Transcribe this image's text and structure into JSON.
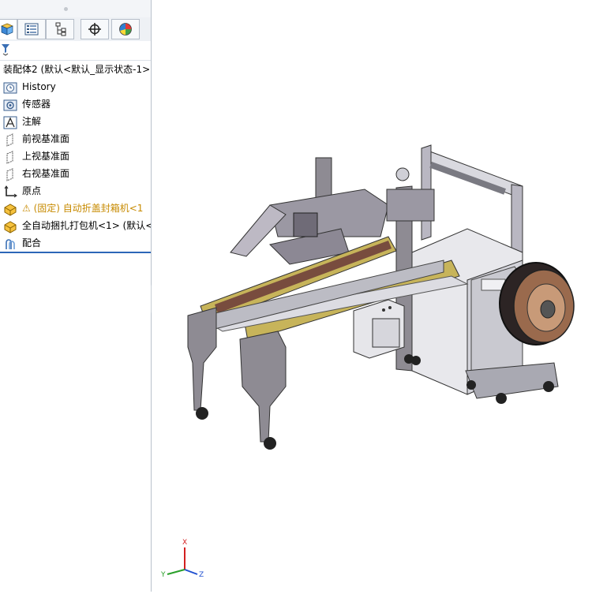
{
  "feature_tree": {
    "root_label": "装配体2  (默认<默认_显示状态-1>",
    "items": [
      {
        "label": "History",
        "icon": "history-icon"
      },
      {
        "label": "传感器",
        "icon": "sensor-icon"
      },
      {
        "label": "注解",
        "icon": "annotation-icon"
      },
      {
        "label": "前视基准面",
        "icon": "plane-icon"
      },
      {
        "label": "上视基准面",
        "icon": "plane-icon"
      },
      {
        "label": "右视基准面",
        "icon": "plane-icon"
      },
      {
        "label": "原点",
        "icon": "origin-icon"
      },
      {
        "label": "⚠ (固定) 自动折盖封箱机<1",
        "icon": "part-warning-icon",
        "color": "#c78a00"
      },
      {
        "label": "全自动捆扎打包机<1> (默认<",
        "icon": "part-icon"
      },
      {
        "label": "配合",
        "icon": "mates-icon"
      }
    ]
  },
  "tabs": [
    {
      "name": "featuremanager-tab",
      "icon": "cube-icon"
    },
    {
      "name": "propertymanager-tab",
      "icon": "property-list-icon"
    },
    {
      "name": "configuration-tab",
      "icon": "configuration-icon"
    },
    {
      "name": "dimxpert-tab",
      "icon": "crosshair-icon"
    },
    {
      "name": "display-tab",
      "icon": "appearance-pie-icon"
    }
  ],
  "triad": {
    "x": "X",
    "y": "Y",
    "z": "Z"
  },
  "colors": {
    "warning": "#c78a00",
    "accent": "#2c66b8",
    "machine_frame": "#8b8790",
    "beam": "#c7b45a"
  }
}
